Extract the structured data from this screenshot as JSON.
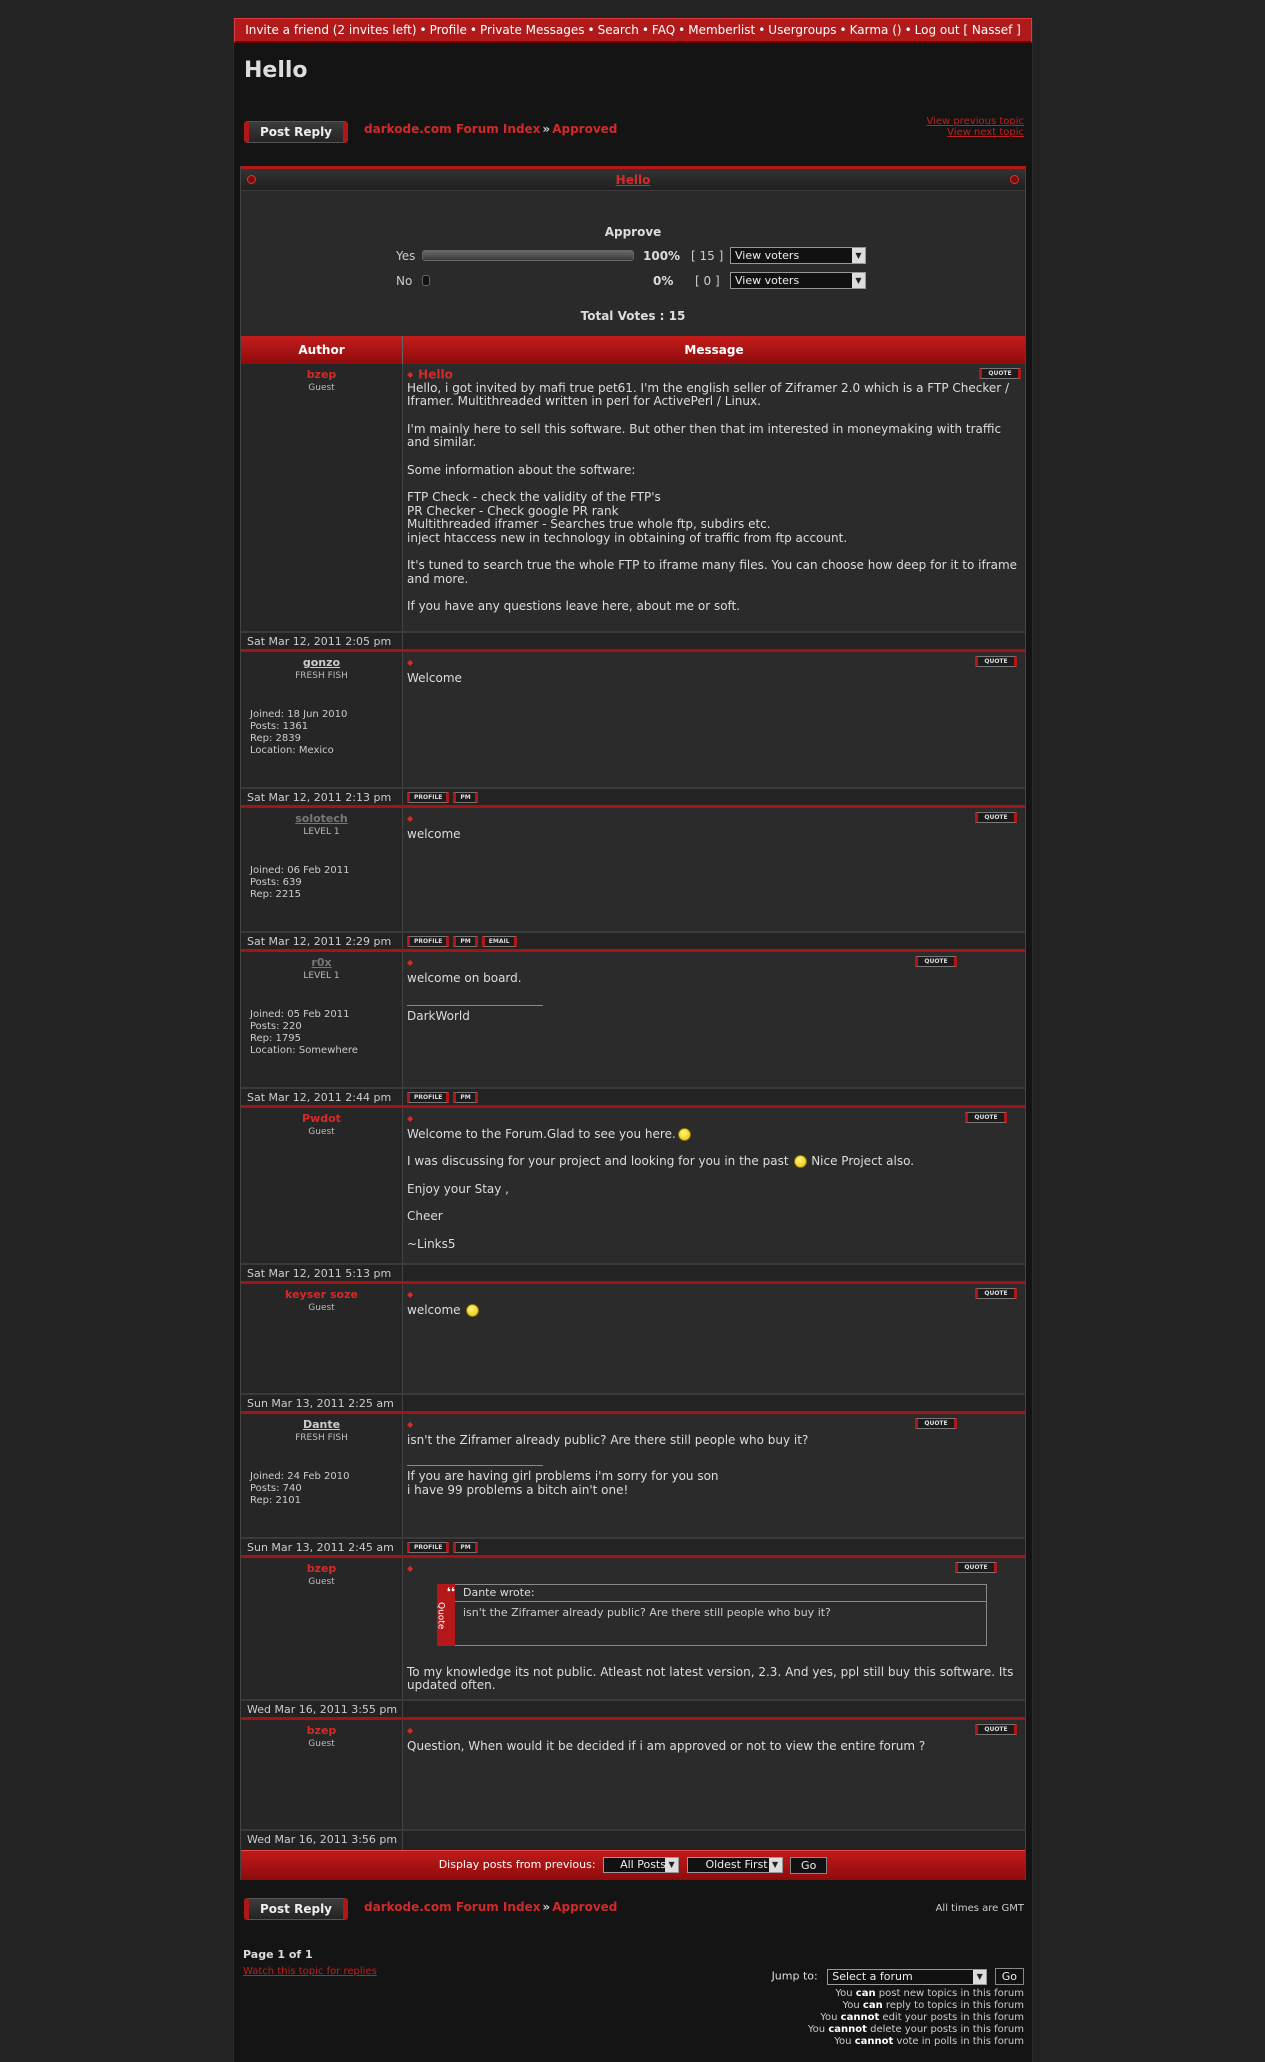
{
  "nav": {
    "items": [
      "Invite a friend (2 invites left)",
      "Profile",
      "Private Messages",
      "Search",
      "FAQ",
      "Memberlist",
      "Usergroups",
      "Karma ()",
      "Log out [ Nassef ]"
    ],
    "separator": "•"
  },
  "page_title": "Hello",
  "post_reply_label": "Post Reply",
  "breadcrumb": {
    "forum_index": "darkode.com Forum Index",
    "separator": "»",
    "current": "Approved"
  },
  "topic_nav": {
    "previous": "View previous topic",
    "next": "View next topic"
  },
  "poll": {
    "topic_title": "Hello",
    "question": "Approve",
    "options": [
      {
        "label": "Yes",
        "percent": "100%",
        "percent_value": 100,
        "count": "[ 15 ]",
        "voters": "View voters"
      },
      {
        "label": "No",
        "percent": "0%",
        "percent_value": 0,
        "count": "[ 0 ]",
        "voters": "View voters"
      }
    ],
    "total": "Total Votes : 15"
  },
  "columns": {
    "author": "Author",
    "message": "Message"
  },
  "quote_label": "QUOTE",
  "buttons": {
    "profile": "PROFILE",
    "pm": "PM",
    "email": "EMAIL"
  },
  "posts": [
    {
      "author": "bzep",
      "rank": "Guest",
      "subject": "Hello",
      "body": [
        "Hello, i got invited by mafi true pet61. I'm the english seller of Ziframer 2.0 which is a FTP Checker / Iframer. Multithreaded written in perl for ActivePerl / Linux.",
        "I'm mainly here to sell this software. But other then that im interested in moneymaking with traffic and similar.",
        "Some information about the software:",
        "FTP Check - check the validity of the FTP's",
        "PR Checker - Check google PR rank",
        "Multithreaded iframer - Searches true whole ftp, subdirs etc.",
        "inject htaccess new in technology in obtaining of traffic from ftp account.",
        "It's tuned to search true the whole FTP to iframe many files. You can choose how deep for it to iframe and more.",
        "If you have any questions leave here, about me or soft."
      ],
      "date": "Sat Mar 12, 2011 2:05 pm"
    },
    {
      "author": "gonzo",
      "rank": "FRESH FISH",
      "joined": "Joined: 18 Jun 2010",
      "posts": "Posts: 1361",
      "rep": "Rep: 2839",
      "location": "Location: Mexico",
      "body": [
        "Welcome"
      ],
      "date": "Sat Mar 12, 2011 2:13 pm"
    },
    {
      "author": "solotech",
      "rank": "LEVEL 1",
      "joined": "Joined: 06 Feb 2011",
      "posts": "Posts: 639",
      "rep": "Rep: 2215",
      "body": [
        "welcome"
      ],
      "date": "Sat Mar 12, 2011 2:29 pm"
    },
    {
      "author": "r0x",
      "rank": "LEVEL 1",
      "joined": "Joined: 05 Feb 2011",
      "posts": "Posts: 220",
      "rep": "Rep: 1795",
      "location": "Location: Somewhere",
      "body": [
        "welcome on board."
      ],
      "signature": [
        "DarkWorld"
      ],
      "date": "Sat Mar 12, 2011 2:44 pm"
    },
    {
      "author": "Pwdot",
      "rank": "Guest",
      "body": [
        "Welcome to the Forum.Glad to see you here.",
        "I was discussing for your project and looking for you in the past",
        "Nice Project also.",
        "Enjoy your Stay ,",
        "Cheer",
        "~Links5"
      ],
      "date": "Sat Mar 12, 2011 5:13 pm"
    },
    {
      "author": "keyser soze",
      "rank": "Guest",
      "body": [
        "welcome"
      ],
      "date": "Sun Mar 13, 2011 2:25 am"
    },
    {
      "author": "Dante",
      "rank": "FRESH FISH",
      "joined": "Joined: 24 Feb 2010",
      "posts": "Posts: 740",
      "rep": "Rep: 2101",
      "body": [
        "isn't the Ziframer already public? Are there still people who buy it?"
      ],
      "signature": [
        "If you are having girl problems i'm sorry for you son",
        "i have 99 problems a bitch ain't one!"
      ],
      "date": "Sun Mar 13, 2011 2:45 am"
    },
    {
      "author": "bzep",
      "rank": "Guest",
      "quote": {
        "tab": "Quote",
        "header": "Dante wrote:",
        "text": "isn't the Ziframer already public? Are there still people who buy it?"
      },
      "body": [
        "To my knowledge its not public. Atleast not latest version, 2.3. And yes, ppl still buy this software. Its updated often."
      ],
      "date": "Wed Mar 16, 2011 3:55 pm"
    },
    {
      "author": "bzep",
      "rank": "Guest",
      "body": [
        "Question, When would it be decided if i am approved or not to view the entire forum ?"
      ],
      "date": "Wed Mar 16, 2011 3:56 pm"
    }
  ],
  "display": {
    "label": "Display posts from previous:",
    "period": "All Posts",
    "order": "Oldest First",
    "go": "Go"
  },
  "timezone": "All times are GMT",
  "pagination": "Page 1 of 1",
  "watch": "Watch this topic for replies",
  "jump": {
    "label": "Jump to:",
    "select": "Select a forum",
    "go": "Go"
  },
  "permissions": [
    {
      "pre": "You",
      "bold": "can",
      "post": "post new topics in this forum"
    },
    {
      "pre": "You",
      "bold": "can",
      "post": "reply to topics in this forum"
    },
    {
      "pre": "You",
      "bold": "cannot",
      "post": "edit your posts in this forum"
    },
    {
      "pre": "You",
      "bold": "cannot",
      "post": "delete your posts in this forum"
    },
    {
      "pre": "You",
      "bold": "cannot",
      "post": "vote in polls in this forum"
    }
  ],
  "colors": {
    "accent": "#b11a1a",
    "background": "#232323",
    "panel": "#2b2b2b"
  }
}
